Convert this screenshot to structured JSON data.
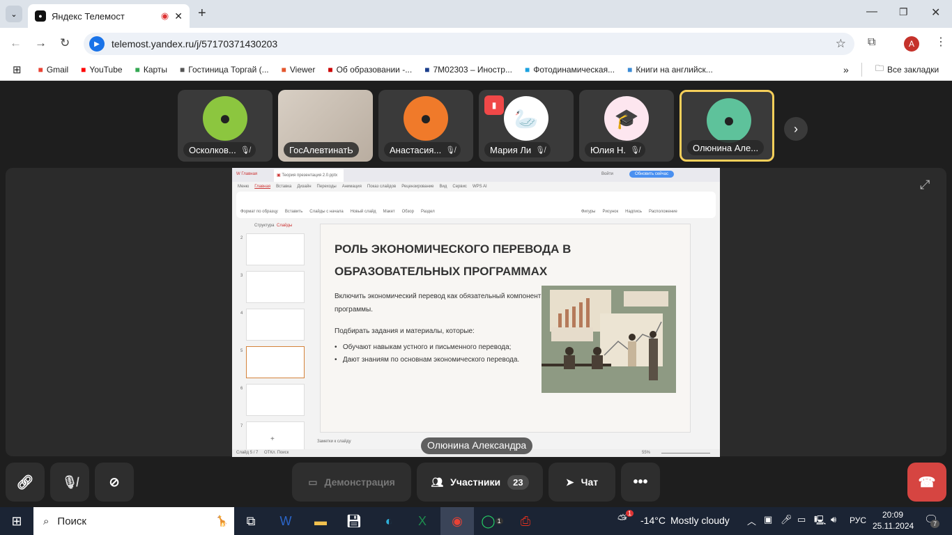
{
  "browser": {
    "tab_title": "Яндекс Телемост",
    "url": "telemost.yandex.ru/j/57170371430203",
    "profile_initial": "A",
    "bookmarks": [
      {
        "label": "Gmail",
        "icon": "gmail-icon",
        "color": "#ea4335"
      },
      {
        "label": "YouTube",
        "icon": "youtube-icon",
        "color": "#ff0000"
      },
      {
        "label": "Карты",
        "icon": "maps-icon",
        "color": "#34a853"
      },
      {
        "label": "Гостиница Торгай (...",
        "icon": "hotel-icon",
        "color": "#555"
      },
      {
        "label": "Viewer",
        "icon": "viewer-icon",
        "color": "#e4572e"
      },
      {
        "label": "Об образовании -...",
        "icon": "search-icon",
        "color": "#c00"
      },
      {
        "label": "7M02303 – Иностр...",
        "icon": "site-icon",
        "color": "#1a3e8c"
      },
      {
        "label": "Фотодинамическая...",
        "icon": "plus-icon",
        "color": "#1aa1e0"
      },
      {
        "label": "Книги на английск...",
        "icon": "lb-icon",
        "color": "#3a8bd6"
      }
    ],
    "all_bookmarks": "Все закладки"
  },
  "participants": [
    {
      "name": "Осколков...",
      "avatar": "person",
      "color": "#8cc63f",
      "muted": true
    },
    {
      "name": "ГосАлевтинатЬ",
      "avatar": "video",
      "color": "#c9bfb3",
      "muted": false
    },
    {
      "name": "Анастасия...",
      "avatar": "person",
      "color": "#f07a2a",
      "muted": true
    },
    {
      "name": "Мария Ли",
      "avatar": "🦢",
      "color": "#ffffff",
      "muted": true,
      "speaking_badge": true
    },
    {
      "name": "Юлия Н.",
      "avatar": "🎓",
      "color": "#fde6ef",
      "muted": true
    },
    {
      "name": "Олюнина Але...",
      "avatar": "person",
      "color": "#5ec29b",
      "muted": false,
      "active": true
    }
  ],
  "presenter": "Олюнина Александра",
  "wps": {
    "tabs": [
      "Главная",
      "Теория презентация 2.0.pptx"
    ],
    "login": "Войти",
    "update": "Обновить сейчас",
    "menu": [
      "Меню",
      "Главная",
      "Вставка",
      "Дизайн",
      "Переходы",
      "Анимация",
      "Показ слайдов",
      "Рецензирование",
      "Вид",
      "Сервис",
      "WPS AI"
    ],
    "panel_tabs": [
      "Структура",
      "Слайды"
    ],
    "status_left": "Слайд 5 / 7",
    "status_lang": "ОТКл. Поиск",
    "notes": "Заметки к слайду",
    "zoom": "55%",
    "ribbon": [
      "Формат по образцу",
      "Вставить",
      "Слайды с начала",
      "Новый слайд",
      "Макет",
      "Обзор",
      "Раздел",
      "Фигуры",
      "Рисунок",
      "Надпись",
      "Расположение"
    ],
    "thumb_numbers": [
      "2",
      "3",
      "4",
      "5",
      "6",
      "7"
    ]
  },
  "slide": {
    "title": "РОЛЬ ЭКОНОМИЧЕСКОГО ПЕРЕВОДА В ОБРАЗОВАТЕЛЬНЫХ ПРОГРАММАХ",
    "p1": "Включить экономический перевод как обязательный компонент программы.",
    "p2": "Подбирать задания и материалы, которые:",
    "bullets": [
      "Обучают навыкам устного и письменного перевода;",
      "Дают знаниям по основнам экономического перевода."
    ]
  },
  "toolbar": {
    "demo": "Демонстрация",
    "participants": "Участники",
    "participants_count": "23",
    "chat": "Чат"
  },
  "taskbar": {
    "search": "Поиск",
    "weather_temp": "-14°C",
    "weather_text": "Mostly cloudy",
    "weather_badge": "1",
    "lang": "РУС",
    "time": "20:09",
    "date": "25.11.2024",
    "notif_count": "7",
    "whatsapp_badge": "1"
  }
}
